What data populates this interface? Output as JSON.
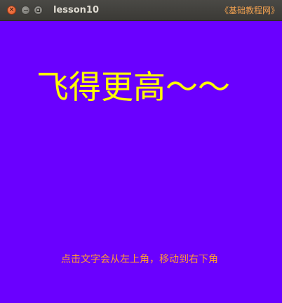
{
  "window": {
    "title": "lesson10",
    "watermark": "《基础教程网》",
    "buttons": {
      "close_icon": "×",
      "minimize_icon": "–",
      "maximize_icon": "□"
    }
  },
  "content": {
    "headline": "飞得更高～～",
    "hint": "点击文字会从左上角，移动到右下角"
  },
  "colors": {
    "background": "#6a00ff",
    "headline": "#ffff00",
    "hint": "#ff9933",
    "watermark": "#f0a050",
    "titlebar": "#3c3b37"
  }
}
